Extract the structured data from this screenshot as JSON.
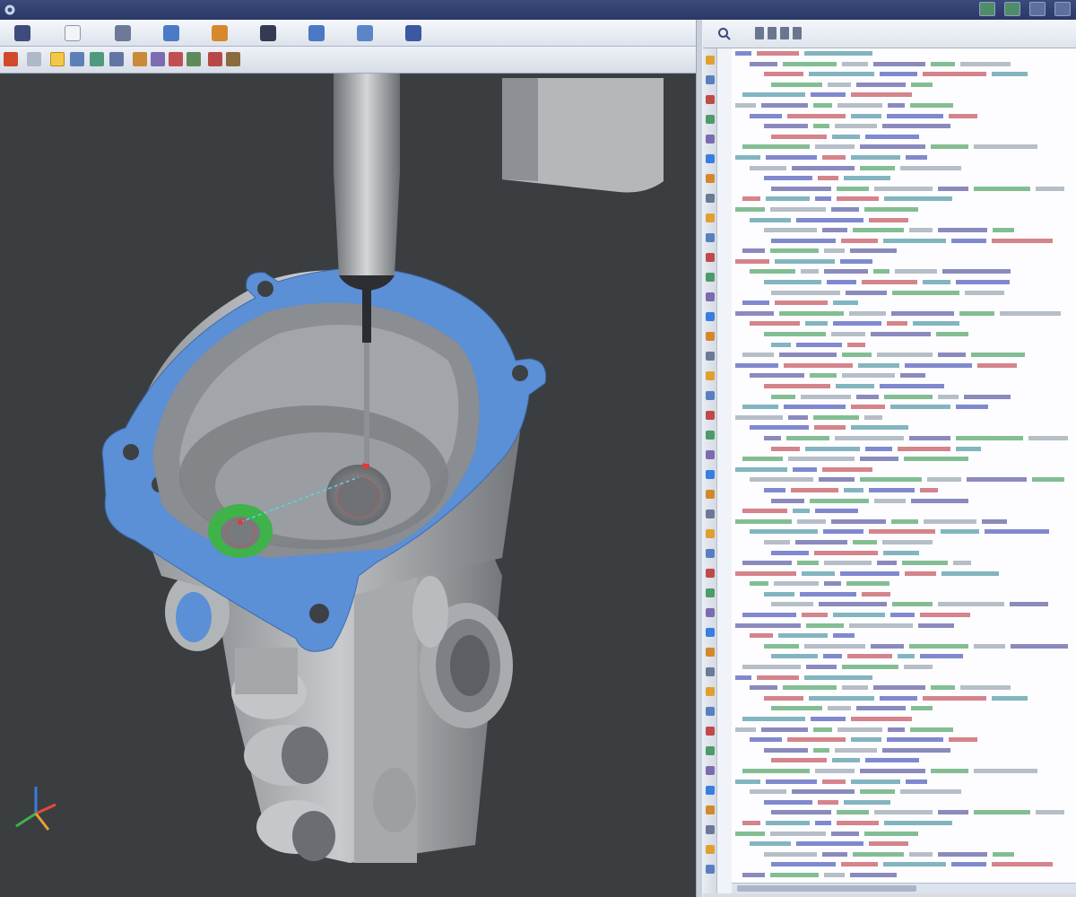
{
  "app": {
    "title_text": "",
    "icons": {
      "app": "app-icon",
      "window_buttons": [
        "layout-icon",
        "tools-icon",
        "restore-icon",
        "close-icon"
      ]
    }
  },
  "menubar": {
    "icons": [
      "home-icon",
      "page-icon",
      "table-icon",
      "probe-icon",
      "tool-icon",
      "arrow-down-icon",
      "flag-icon",
      "import-icon",
      "save-icon"
    ]
  },
  "toolbar": {
    "icons": [
      "undo-icon",
      "redo-icon",
      "rotate-icon",
      "zoom-icon",
      "pan-icon",
      "select-icon",
      "probe-path-icon",
      "fit-icon",
      "measure-icon",
      "section-icon",
      "points-icon"
    ]
  },
  "viewport": {
    "name": "3d-model-viewport",
    "axis_triad": "axis-triad-icon"
  },
  "code_panel": {
    "search_icon": "search-icon",
    "lines": []
  },
  "colors": {
    "viewport_bg": "#3b3e41",
    "flange_blue": "#5b8fd6",
    "highlight_green": "#3fb24a",
    "part_gray": "#b8babd",
    "keyword": "#1a2aa8",
    "value_red": "#b3202a",
    "value_green": "#1f8a3a"
  }
}
